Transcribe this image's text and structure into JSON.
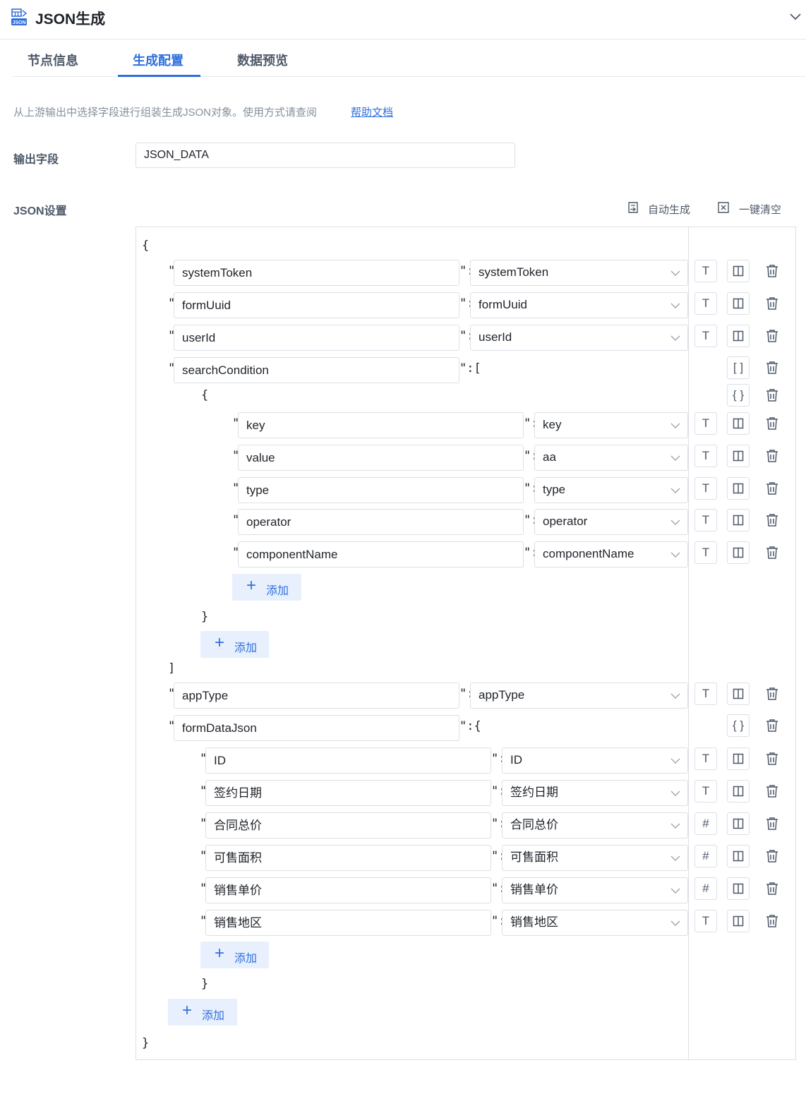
{
  "header": {
    "title": "JSON生成",
    "icon_caption": "JSON"
  },
  "tabs": [
    {
      "label": "节点信息"
    },
    {
      "label": "生成配置",
      "active": true
    },
    {
      "label": "数据预览"
    }
  ],
  "description": "从上游输出中选择字段进行组装生成JSON对象。使用方式请查阅",
  "help_link": "帮助文档",
  "output_field": {
    "label": "输出字段",
    "value": "JSON_DATA"
  },
  "json_settings": {
    "label": "JSON设置",
    "auto_generate": "自动生成",
    "clear_all": "一键清空"
  },
  "punct": {
    "open_obj": "{",
    "close_obj": "}",
    "open_arr": "[",
    "close_arr": "]",
    "quote": "\"",
    "colon": "\":",
    "colon_arr": "\":[",
    "colon_obj": "\":{"
  },
  "add_label": "添加",
  "type_icons": {
    "text": "T",
    "number": "#",
    "array": "[ ]",
    "object": "{ }"
  },
  "rows": {
    "systemToken": {
      "key": "systemToken",
      "value": "systemToken",
      "type": "text"
    },
    "formUuid": {
      "key": "formUuid",
      "value": "formUuid",
      "type": "text"
    },
    "userId": {
      "key": "userId",
      "value": "userId",
      "type": "text"
    },
    "searchCondition": {
      "key": "searchCondition",
      "type": "array"
    },
    "sc_key": {
      "key": "key",
      "value": "key",
      "type": "text"
    },
    "sc_value": {
      "key": "value",
      "value": "aa",
      "type": "text"
    },
    "sc_type": {
      "key": "type",
      "value": "type",
      "type": "text"
    },
    "sc_operator": {
      "key": "operator",
      "value": "operator",
      "type": "text"
    },
    "sc_componentName": {
      "key": "componentName",
      "value": "componentName",
      "type": "text"
    },
    "appType": {
      "key": "appType",
      "value": "appType",
      "type": "text"
    },
    "formDataJson": {
      "key": "formDataJson",
      "type": "object"
    },
    "fd_id": {
      "key": "ID",
      "value": "ID",
      "type": "text"
    },
    "fd_sign_date": {
      "key": "签约日期",
      "value": "签约日期",
      "type": "text"
    },
    "fd_total_price": {
      "key": "合同总价",
      "value": "合同总价",
      "type": "number"
    },
    "fd_area": {
      "key": "可售面积",
      "value": "可售面积",
      "type": "number"
    },
    "fd_unit_price": {
      "key": "销售单价",
      "value": "销售单价",
      "type": "number"
    },
    "fd_region": {
      "key": "销售地区",
      "value": "销售地区",
      "type": "text"
    }
  },
  "colors": {
    "accent": "#2f6fdb",
    "border": "#dcdfe6",
    "add_bg": "#e8f0fe",
    "muted": "#86909c"
  }
}
